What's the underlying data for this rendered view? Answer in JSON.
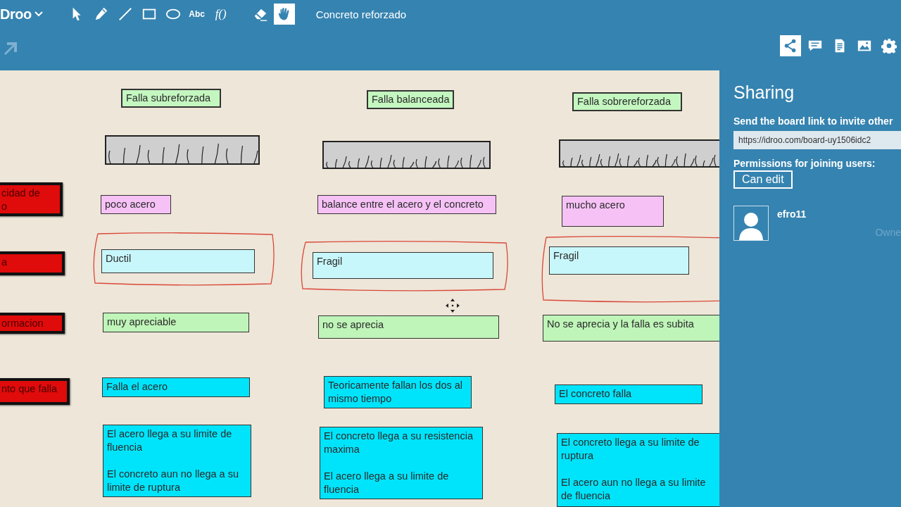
{
  "toolbar": {
    "logo": "Droo",
    "tools": [
      {
        "kind": "select",
        "selected": false
      },
      {
        "kind": "pencil",
        "selected": false
      },
      {
        "kind": "line",
        "selected": false
      },
      {
        "kind": "rectangle",
        "selected": false
      },
      {
        "kind": "ellipse",
        "selected": false
      },
      {
        "kind": "text",
        "label": "Abc",
        "selected": false
      },
      {
        "kind": "formula",
        "label": "f()",
        "selected": false
      },
      {
        "kind": "eraser",
        "selected": false
      },
      {
        "kind": "hand",
        "selected": true
      }
    ],
    "board_title": "Concreto reforzado",
    "panel_tabs": [
      {
        "kind": "share",
        "selected": true
      },
      {
        "kind": "chat",
        "selected": false
      },
      {
        "kind": "document",
        "selected": false
      },
      {
        "kind": "image",
        "selected": false
      },
      {
        "kind": "settings",
        "selected": false
      }
    ]
  },
  "row_labels": [
    {
      "text": "cidad  de\no",
      "color": "#e00b0b"
    },
    {
      "text": "a",
      "color": "#e00b0b"
    },
    {
      "text": "ormacion",
      "color": "#e00b0b"
    },
    {
      "text": "nto que falla",
      "color": "#e00b0b"
    }
  ],
  "columns": [
    {
      "header": {
        "text": "Falla subreforzada",
        "color": "#c4f7c0"
      },
      "notes": [
        {
          "text": "poco acero",
          "color": "#f6c2f6"
        },
        {
          "text": "Ductil",
          "color": "#c8f7fb"
        },
        {
          "text": "muy apreciable",
          "color": "#bff5b8"
        },
        {
          "text": "Falla el acero",
          "color": "#00e4fb"
        },
        {
          "text": "El acero llega a su limite de fluencia\n\nEl concreto aun no llega a su limite de ruptura",
          "color": "#00e4fb"
        }
      ]
    },
    {
      "header": {
        "text": "Falla balanceada",
        "color": "#c4f7c0"
      },
      "notes": [
        {
          "text": "balance entre el acero y el concreto",
          "color": "#f6c2f6"
        },
        {
          "text": "Fragil",
          "color": "#c8f7fb"
        },
        {
          "text": "no se aprecia",
          "color": "#bff5b8"
        },
        {
          "text": "Teoricamente fallan los dos al mismo tiempo",
          "color": "#00e4fb"
        },
        {
          "text": "El concreto llega a su resistencia maxima\n\nEl acero llega a su limite de fluencia",
          "color": "#00e4fb"
        }
      ]
    },
    {
      "header": {
        "text": "Falla sobrereforzada",
        "color": "#c4f7c0"
      },
      "notes": [
        {
          "text": "mucho acero",
          "color": "#f6c2f6"
        },
        {
          "text": "Fragil",
          "color": "#c8f7fb"
        },
        {
          "text": "No se aprecia y la falla es subita",
          "color": "#bff5b8"
        },
        {
          "text": "El concreto falla",
          "color": "#00e4fb"
        },
        {
          "text": "El concreto llega a su limite de ruptura\n\nEl acero aun no llega a su limite de fluencia",
          "color": "#00e4fb"
        }
      ]
    }
  ],
  "sharing": {
    "title": "Sharing",
    "invite_text": "Send the board link to invite other",
    "link": "https://idroo.com/board-uy1506idc2",
    "permissions_label": "Permissions for joining users:",
    "permission": "Can edit",
    "users": [
      {
        "name": "efro11",
        "role": "Owne"
      }
    ]
  }
}
